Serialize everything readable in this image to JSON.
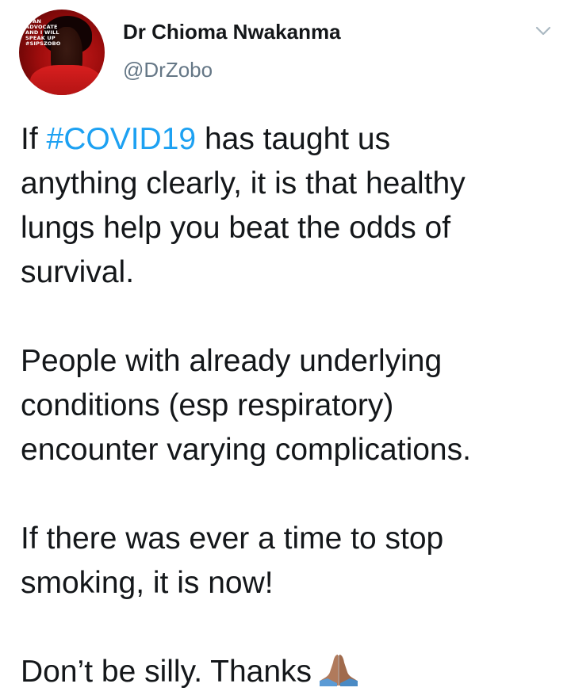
{
  "author": {
    "display_name": "Dr Chioma Nwakanma",
    "handle": "@DrZobo",
    "avatar_text_lines": [
      "M AN",
      "ADVOCATE",
      "AND I WILL",
      "SPEAK UP",
      "#SIPSZOBO"
    ]
  },
  "menu": {
    "icon": "chevron-down-icon"
  },
  "tweet": {
    "p1": {
      "before": "If ",
      "hashtag": "#COVID19",
      "line1_after": " has taught us",
      "line2": "anything clearly, it is that healthy",
      "line3": "lungs help you beat the odds of",
      "line4": "survival."
    },
    "p2": {
      "line1": "People with already underlying",
      "line2": "conditions (esp respiratory)",
      "line3": "encounter varying complications."
    },
    "p3": {
      "line1": "If there was ever a time to stop",
      "line2": "smoking, it is now!"
    },
    "p4": {
      "text": "Don’t be silly. Thanks",
      "emoji": "folded-hands-icon"
    }
  },
  "colors": {
    "hashtag": "#1da1f2",
    "handle": "#657786",
    "text": "#14171a",
    "chevron": "#aab8c2"
  }
}
